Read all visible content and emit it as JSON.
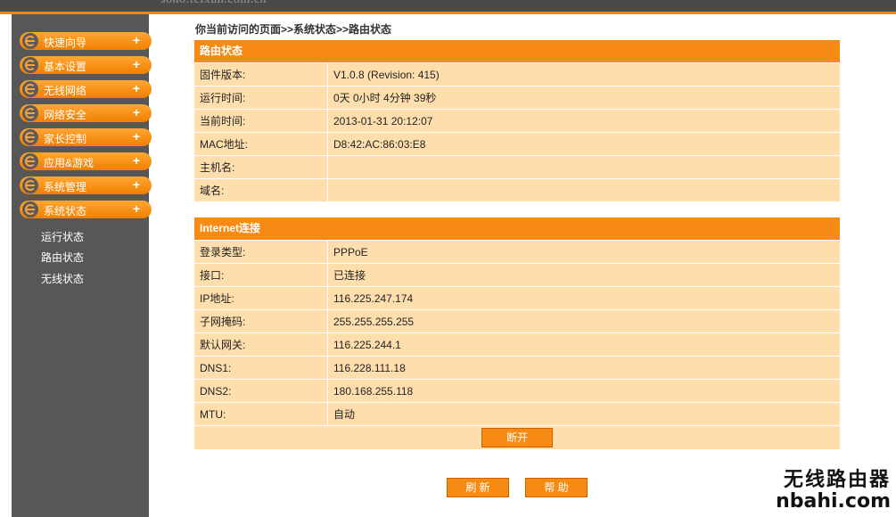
{
  "header": {
    "domain": "sono.feixun.com.cn"
  },
  "sidebar": {
    "menu": [
      {
        "label": "快速向导",
        "expand": "+"
      },
      {
        "label": "基本设置",
        "expand": "+"
      },
      {
        "label": "无线网络",
        "expand": "+"
      },
      {
        "label": "网络安全",
        "expand": "+"
      },
      {
        "label": "家长控制",
        "expand": "+"
      },
      {
        "label": "应用&游戏",
        "expand": "+"
      },
      {
        "label": "系统管理",
        "expand": "+"
      },
      {
        "label": "系统状态",
        "expand": "+"
      }
    ],
    "submenu": [
      "运行状态",
      "路由状态",
      "无线状态"
    ]
  },
  "breadcrumb": "你当前访问的页面>>系统状态>>路由状态",
  "router_status": {
    "title": "路由状态",
    "rows": [
      {
        "key": "固件版本:",
        "value": "V1.0.8 (Revision: 415)"
      },
      {
        "key": "运行时间:",
        "value": "0天  0小时  4分钟  39秒"
      },
      {
        "key": "当前时间:",
        "value": "2013-01-31 20:12:07"
      },
      {
        "key": "MAC地址:",
        "value": "D8:42:AC:86:03:E8"
      },
      {
        "key": "主机名:",
        "value": ""
      },
      {
        "key": "域名:",
        "value": ""
      }
    ]
  },
  "internet": {
    "title": "Internet连接",
    "rows": [
      {
        "key": "登录类型:",
        "value": "PPPoE"
      },
      {
        "key": "接口:",
        "value": "已连接"
      },
      {
        "key": "IP地址:",
        "value": "116.225.247.174"
      },
      {
        "key": "子网掩码:",
        "value": "255.255.255.255"
      },
      {
        "key": "默认网关:",
        "value": "116.225.244.1"
      },
      {
        "key": "DNS1:",
        "value": "116.228.111.18"
      },
      {
        "key": "DNS2:",
        "value": "180.168.255.118"
      },
      {
        "key": "MTU:",
        "value": "自动"
      }
    ],
    "disconnect_label": "断开"
  },
  "footer": {
    "refresh_label": "刷 新",
    "help_label": "帮 助"
  },
  "watermark": {
    "line1": "无线路由器",
    "line2": "nbahi.com"
  },
  "colors": {
    "accent": "#f68a12",
    "row_bg": "#ffdeae",
    "sidebar": "#575757"
  }
}
